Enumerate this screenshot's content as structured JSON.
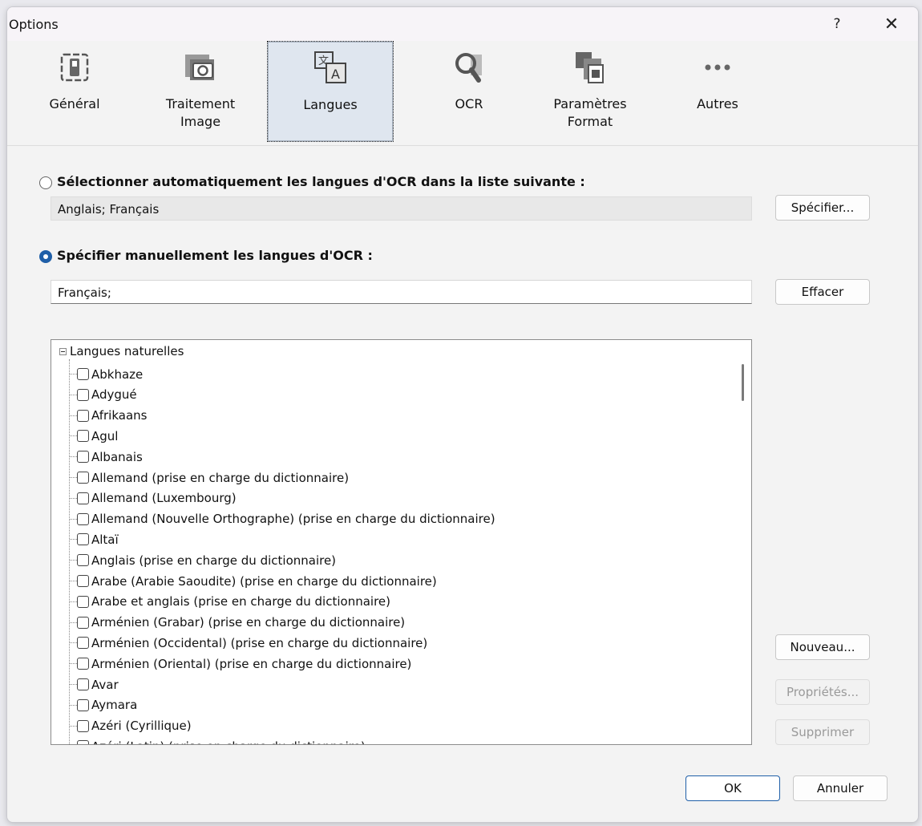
{
  "window": {
    "title": "Options",
    "help": "?",
    "close": "✕"
  },
  "toolbar": [
    {
      "label": "Général",
      "icon": "general-settings-icon"
    },
    {
      "label": "Traitement Image",
      "icon": "image-processing-icon"
    },
    {
      "label": "Langues",
      "icon": "languages-icon",
      "selected": true
    },
    {
      "label": "OCR",
      "icon": "ocr-magnifier-icon"
    },
    {
      "label": "Paramètres Format",
      "icon": "format-settings-icon"
    },
    {
      "label": "Autres",
      "icon": "more-icon"
    }
  ],
  "auto": {
    "label": "Sélectionner automatiquement les langues d'OCR dans la liste suivante :",
    "value": "Anglais; Français",
    "button": "Spécifier...",
    "selected": false
  },
  "manual": {
    "label": "Spécifier manuellement les langues d'OCR :",
    "value": "Français;",
    "button": "Effacer",
    "selected": true
  },
  "tree": {
    "root": "Langues naturelles",
    "items": [
      "Abkhaze",
      "Adygué",
      "Afrikaans",
      "Agul",
      "Albanais",
      "Allemand (prise en charge du dictionnaire)",
      "Allemand (Luxembourg)",
      "Allemand (Nouvelle Orthographe) (prise en charge du dictionnaire)",
      "Altaï",
      "Anglais (prise en charge du dictionnaire)",
      "Arabe (Arabie Saoudite) (prise en charge du dictionnaire)",
      "Arabe et anglais (prise en charge du dictionnaire)",
      "Arménien (Grabar) (prise en charge du dictionnaire)",
      "Arménien (Occidental) (prise en charge du dictionnaire)",
      "Arménien (Oriental) (prise en charge du dictionnaire)",
      "Avar",
      "Aymara",
      "Azéri (Cyrillique)",
      "Azéri (Latin) (prise en charge du dictionnaire)"
    ]
  },
  "side_buttons": {
    "new": "Nouveau...",
    "props": "Propriétés...",
    "delete": "Supprimer"
  },
  "footer": {
    "ok": "OK",
    "cancel": "Annuler"
  }
}
